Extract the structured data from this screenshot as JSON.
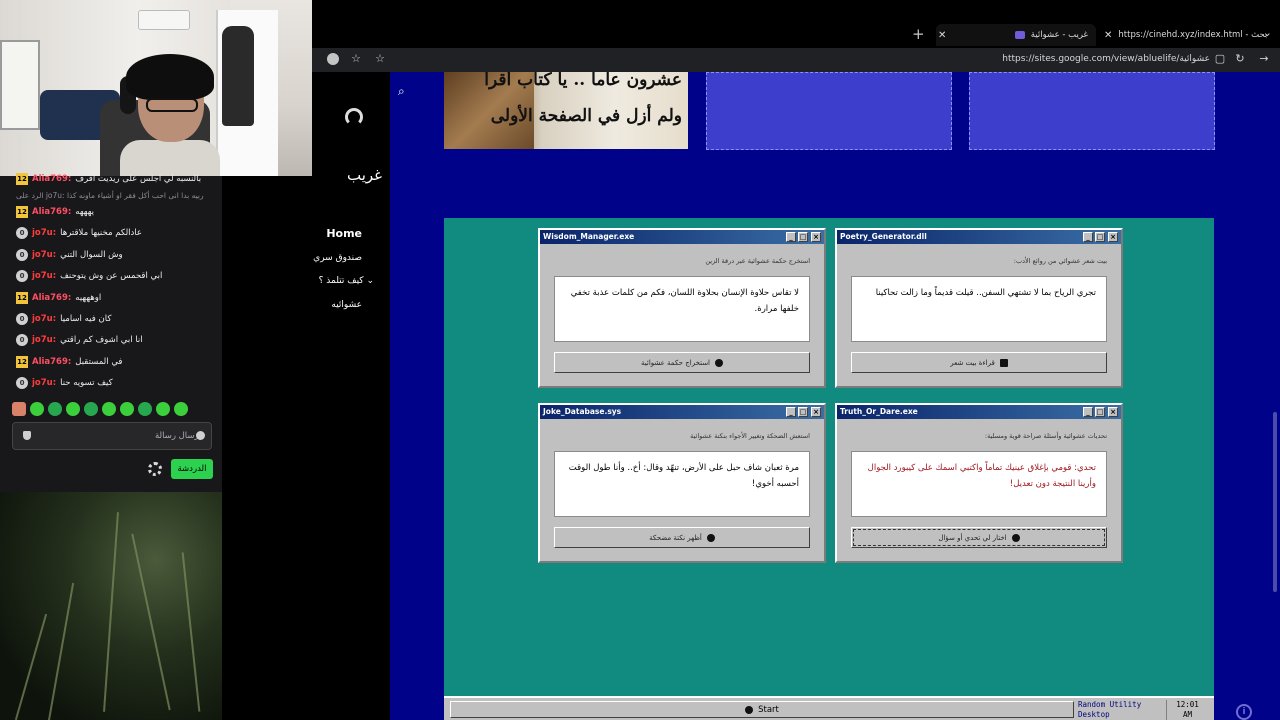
{
  "browser": {
    "tabs": [
      {
        "label": "غريب - عشوائية",
        "active": true
      },
      {
        "label": "https://cinehd.xyz/index.html - بحث",
        "active": false
      }
    ],
    "url": "https://sites.google.com/view/abluelife/عشوائية"
  },
  "chat": {
    "reply_preview": "الرد على jo7u: ربيه بدا انى احب أكل فقر او أشياء ماونه كذا",
    "messages": [
      {
        "badge": "12",
        "badge_type": "gold",
        "user": "Alia769:",
        "user_class": "a",
        "text": "بالنسبه لي اجلس على ريديت اقرف"
      },
      {
        "badge": "12",
        "badge_type": "gold",
        "user": "Alia769:",
        "user_class": "a",
        "text": "يهههه"
      },
      {
        "badge": "0",
        "badge_type": "round",
        "user": "jo7u:",
        "user_class": "j",
        "text": "عادالكم مخنيها ملاقترها"
      },
      {
        "badge": "0",
        "badge_type": "round",
        "user": "jo7u:",
        "user_class": "j",
        "text": "وش السوال التني"
      },
      {
        "badge": "0",
        "badge_type": "round",
        "user": "jo7u:",
        "user_class": "j",
        "text": "ابي اقحمس عن وش يتوحنف"
      },
      {
        "badge": "12",
        "badge_type": "gold",
        "user": "Alia769:",
        "user_class": "a",
        "text": "اوهههيه"
      },
      {
        "badge": "0",
        "badge_type": "round",
        "user": "jo7u:",
        "user_class": "j",
        "text": "كان فيه اساميا"
      },
      {
        "badge": "0",
        "badge_type": "round",
        "user": "jo7u:",
        "user_class": "j",
        "text": "انا ابي اشوف كم راقتي"
      },
      {
        "badge": "12",
        "badge_type": "gold",
        "user": "Alia769:",
        "user_class": "a",
        "text": "في المستقبل"
      },
      {
        "badge": "0",
        "badge_type": "round",
        "user": "jo7u:",
        "user_class": "j",
        "text": "كيف تسويه حنا"
      }
    ],
    "input_placeholder": "إرسال رسالة",
    "send_label": "الدردشة"
  },
  "site": {
    "title": "غريب",
    "nav": [
      {
        "label": "Home",
        "bold": true
      },
      {
        "label": "صندوق سري",
        "bold": false
      },
      {
        "label": "كيف تتلمذ ؟",
        "bold": false,
        "has_dropdown": true
      },
      {
        "label": "عشوائيه",
        "bold": false
      }
    ],
    "banner_text_top": "عشرون عاما .. يا كتاب أقرأ",
    "banner_text_bottom": "ولم أزل في الصفحة الأولى",
    "windows": [
      {
        "title": "Wisdom_Manager.exe",
        "subtitle": "استخرج حكمة عشوائية عبر درقة الزين",
        "text": "لا تقاس حلاوة الإنسان بحلاوة اللسان، فكم من كلمات عذبة تخفي خلفها مرارة.",
        "button": "استخراج حكمة عشوائية",
        "red": false
      },
      {
        "title": "Poetry_Generator.dll",
        "subtitle": "بيت شعر عشوائي من روائع الأدب:",
        "text": "تجري الرياح بما لا تشتهي السفن.. قيلت قديماً وما زالت تحاكينا",
        "button": "قراءة بيت شعر",
        "red": false
      },
      {
        "title": "Joke_Database.sys",
        "subtitle": "استعش الضحكة وتغيير الأجواء بنكتة عشوائية",
        "text": "مرة ثعبان شاف حبل على الأرض، تنهّد وقال: أخ.. وأنا طول الوقت أحسبه أخوي!",
        "button": "أظهر نكتة مضحكة",
        "red": false
      },
      {
        "title": "Truth_Or_Dare.exe",
        "subtitle": "تحديات عشوائية وأسئلة صراحة قوية ومسلية:",
        "text": "تحدي: قومي بإغلاق عينيك تماماً واكتبي اسمك على كيبورد الجوال وأرينا النتيجة دون تعديل!",
        "button": "اختار لي تحدي أو سؤال",
        "red": true
      }
    ],
    "taskbar": {
      "start_label": "Start",
      "app_label_1": "Random Utility",
      "app_label_2": "Desktop",
      "time_1": "12:01",
      "time_2": "AM"
    }
  },
  "colors": {
    "site_bg": "#01028a",
    "teal_desktop": "#118a80",
    "title_bar": "#0a246a",
    "send_button": "#2bd14f"
  }
}
